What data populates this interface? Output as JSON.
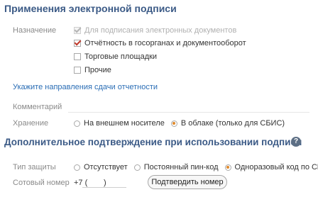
{
  "section1": {
    "title": "Применения электронной подписи",
    "purpose_label": "Назначение",
    "options": [
      {
        "label": "Для подписания электронных документов",
        "checked": true,
        "disabled": true
      },
      {
        "label": "Отчётность в госорганах и документооборот",
        "checked": true,
        "disabled": false
      },
      {
        "label": "Торговые площадки",
        "checked": false,
        "disabled": false
      },
      {
        "label": "Прочие",
        "checked": false,
        "disabled": false
      }
    ],
    "directions_link": "Укажите направления сдачи отчетности",
    "comment_label": "Комментарий",
    "comment_value": "",
    "storage_label": "Хранение",
    "storage_options": [
      {
        "label": "На внешнем носителе",
        "selected": false
      },
      {
        "label": "В облаке (только для СБИС)",
        "selected": true
      }
    ]
  },
  "section2": {
    "title": "Дополнительное подтверждение при использовании подписи",
    "help_icon": "?",
    "protection_label": "Тип защиты",
    "protection_options": [
      {
        "label": "Отсутствует",
        "selected": false
      },
      {
        "label": "Постоянный пин-код",
        "selected": false
      },
      {
        "label": "Одноразовый код по СМС",
        "selected": true
      }
    ],
    "phone_label": "Сотовый номер",
    "phone_prefix": "+7 (",
    "phone_mask": ")",
    "confirm_button": "Подтвердить номер"
  },
  "colors": {
    "title": "#3b5a86",
    "link": "#2a6db5",
    "check": "#c0392b",
    "radio_selected": "#e08a2c"
  }
}
